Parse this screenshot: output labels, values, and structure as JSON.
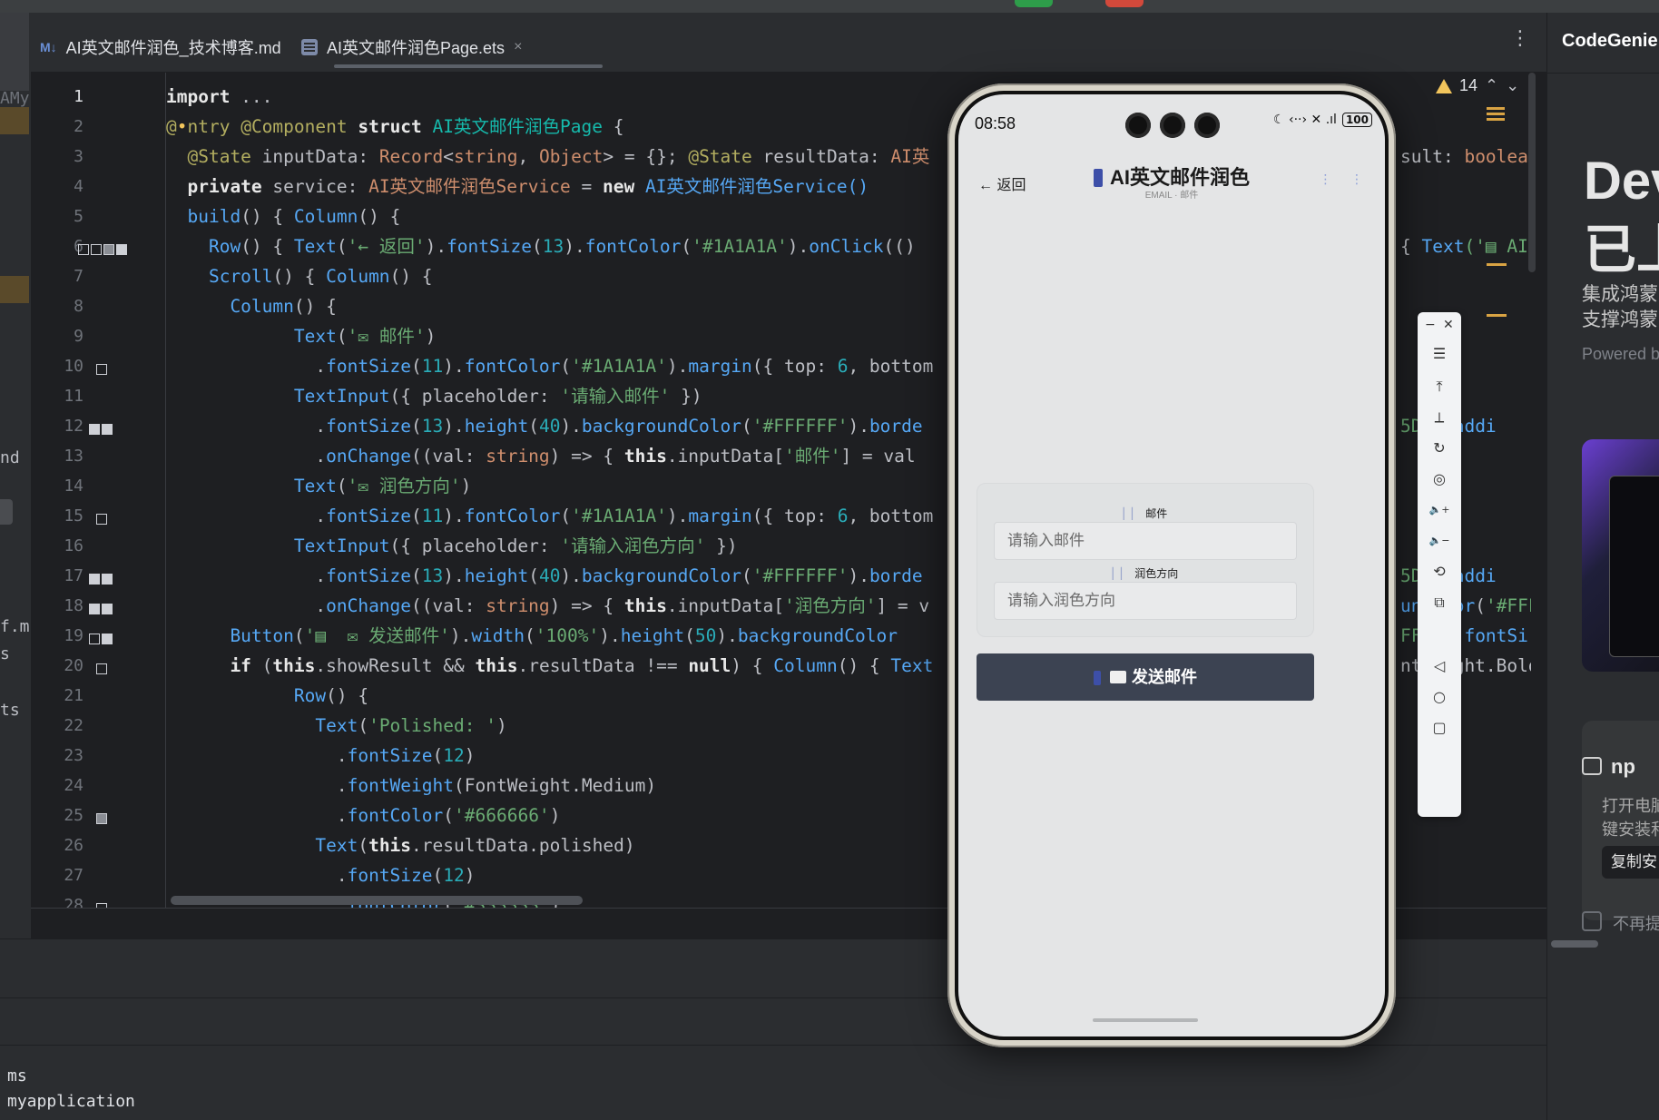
{
  "window": {
    "tabs": [
      {
        "icon": "M↓",
        "label": "AI英文邮件润色_技术博客.md",
        "active": false
      },
      {
        "icon": "ets-file",
        "label": "AI英文邮件润色Page.ets",
        "active": true,
        "close": "×"
      }
    ],
    "more_menu": "⋮"
  },
  "left_strip": {
    "fragments": [
      "AMy",
      "nd",
      "f.mc",
      "s",
      "ts"
    ]
  },
  "editor": {
    "line_numbers": [
      "1",
      "2",
      "3",
      "4",
      "5",
      "6",
      "7",
      "8",
      "9",
      "10",
      "11",
      "12",
      "13",
      "14",
      "15",
      "16",
      "17",
      "18",
      "19",
      "20",
      "21",
      "22",
      "23",
      "24",
      "25",
      "26",
      "27",
      "28"
    ],
    "warnings": {
      "count": "14"
    },
    "lines": [
      [
        {
          "t": "import ",
          "c": "kwb"
        },
        {
          "t": "...",
          "c": "pl"
        }
      ],
      [
        {
          "t": "@",
          "c": "ann"
        },
        {
          "t": "•",
          "c": "warn-ico"
        },
        {
          "t": "ntry @Component ",
          "c": "ann"
        },
        {
          "t": "struct ",
          "c": "kwb"
        },
        {
          "t": "AI英文邮件润色Page",
          "c": "ty"
        },
        {
          "t": " {",
          "c": "pl"
        }
      ],
      [
        {
          "t": "  @State ",
          "c": "ann"
        },
        {
          "t": "inputData: ",
          "c": "pl"
        },
        {
          "t": "Record",
          "c": "kw"
        },
        {
          "t": "<",
          "c": "pl"
        },
        {
          "t": "string",
          "c": "kw"
        },
        {
          "t": ", ",
          "c": "pl"
        },
        {
          "t": "Object",
          "c": "kw"
        },
        {
          "t": "> = {}; ",
          "c": "pl"
        },
        {
          "t": "@State ",
          "c": "ann"
        },
        {
          "t": "resultData: ",
          "c": "pl"
        },
        {
          "t": "AI英",
          "c": "kw"
        }
      ],
      [
        {
          "t": "  private ",
          "c": "kwb"
        },
        {
          "t": "service: ",
          "c": "pl"
        },
        {
          "t": "AI英文邮件润色Service",
          "c": "kw"
        },
        {
          "t": " = ",
          "c": "pl"
        },
        {
          "t": "new ",
          "c": "kwb"
        },
        {
          "t": "AI英文邮件润色Service()",
          "c": "fn"
        }
      ],
      [
        {
          "t": "  build",
          "c": "fn"
        },
        {
          "t": "() { ",
          "c": "pl"
        },
        {
          "t": "Column",
          "c": "fn"
        },
        {
          "t": "() {",
          "c": "pl"
        }
      ],
      [
        {
          "t": "    Row",
          "c": "fn"
        },
        {
          "t": "() { ",
          "c": "pl"
        },
        {
          "t": "Text",
          "c": "fn"
        },
        {
          "t": "(",
          "c": "pl"
        },
        {
          "t": "'← 返回'",
          "c": "str"
        },
        {
          "t": ").",
          "c": "pl"
        },
        {
          "t": "fontSize",
          "c": "fn"
        },
        {
          "t": "(",
          "c": "pl"
        },
        {
          "t": "13",
          "c": "num"
        },
        {
          "t": ").",
          "c": "pl"
        },
        {
          "t": "fontColor",
          "c": "fn"
        },
        {
          "t": "(",
          "c": "pl"
        },
        {
          "t": "'#1A1A1A'",
          "c": "str"
        },
        {
          "t": ").",
          "c": "pl"
        },
        {
          "t": "onClick",
          "c": "fn"
        },
        {
          "t": "(()",
          "c": "pl"
        }
      ],
      [
        {
          "t": "    Scroll",
          "c": "fn"
        },
        {
          "t": "() { ",
          "c": "pl"
        },
        {
          "t": "Column",
          "c": "fn"
        },
        {
          "t": "() {",
          "c": "pl"
        }
      ],
      [
        {
          "t": "      Column",
          "c": "fn"
        },
        {
          "t": "() {",
          "c": "pl"
        }
      ],
      [
        {
          "t": "            Text",
          "c": "fn"
        },
        {
          "t": "(",
          "c": "pl"
        },
        {
          "t": "'✉ 邮件'",
          "c": "str"
        },
        {
          "t": ")",
          "c": "pl"
        }
      ],
      [
        {
          "t": "              .",
          "c": "pl"
        },
        {
          "t": "fontSize",
          "c": "fn"
        },
        {
          "t": "(",
          "c": "pl"
        },
        {
          "t": "11",
          "c": "num"
        },
        {
          "t": ").",
          "c": "pl"
        },
        {
          "t": "fontColor",
          "c": "fn"
        },
        {
          "t": "(",
          "c": "pl"
        },
        {
          "t": "'#1A1A1A'",
          "c": "str"
        },
        {
          "t": ").",
          "c": "pl"
        },
        {
          "t": "margin",
          "c": "fn"
        },
        {
          "t": "({ top: ",
          "c": "pl"
        },
        {
          "t": "6",
          "c": "num"
        },
        {
          "t": ", bottom",
          "c": "pl"
        }
      ],
      [
        {
          "t": "            TextInput",
          "c": "fn"
        },
        {
          "t": "({ placeholder: ",
          "c": "pl"
        },
        {
          "t": "'请输入邮件'",
          "c": "str"
        },
        {
          "t": " })",
          "c": "pl"
        }
      ],
      [
        {
          "t": "              .",
          "c": "pl"
        },
        {
          "t": "fontSize",
          "c": "fn"
        },
        {
          "t": "(",
          "c": "pl"
        },
        {
          "t": "13",
          "c": "num"
        },
        {
          "t": ").",
          "c": "pl"
        },
        {
          "t": "height",
          "c": "fn"
        },
        {
          "t": "(",
          "c": "pl"
        },
        {
          "t": "40",
          "c": "num"
        },
        {
          "t": ").",
          "c": "pl"
        },
        {
          "t": "backgroundColor",
          "c": "fn"
        },
        {
          "t": "(",
          "c": "pl"
        },
        {
          "t": "'#FFFFFF'",
          "c": "str"
        },
        {
          "t": ").",
          "c": "pl"
        },
        {
          "t": "borde",
          "c": "fn"
        }
      ],
      [
        {
          "t": "              .",
          "c": "pl"
        },
        {
          "t": "onChange",
          "c": "fn"
        },
        {
          "t": "((val: ",
          "c": "pl"
        },
        {
          "t": "string",
          "c": "kw"
        },
        {
          "t": ") => { ",
          "c": "pl"
        },
        {
          "t": "this",
          "c": "kwb"
        },
        {
          "t": ".inputData[",
          "c": "pl"
        },
        {
          "t": "'邮件'",
          "c": "str"
        },
        {
          "t": "] = val",
          "c": "pl"
        }
      ],
      [
        {
          "t": "            Text",
          "c": "fn"
        },
        {
          "t": "(",
          "c": "pl"
        },
        {
          "t": "'✉ 润色方向'",
          "c": "str"
        },
        {
          "t": ")",
          "c": "pl"
        }
      ],
      [
        {
          "t": "              .",
          "c": "pl"
        },
        {
          "t": "fontSize",
          "c": "fn"
        },
        {
          "t": "(",
          "c": "pl"
        },
        {
          "t": "11",
          "c": "num"
        },
        {
          "t": ").",
          "c": "pl"
        },
        {
          "t": "fontColor",
          "c": "fn"
        },
        {
          "t": "(",
          "c": "pl"
        },
        {
          "t": "'#1A1A1A'",
          "c": "str"
        },
        {
          "t": ").",
          "c": "pl"
        },
        {
          "t": "margin",
          "c": "fn"
        },
        {
          "t": "({ top: ",
          "c": "pl"
        },
        {
          "t": "6",
          "c": "num"
        },
        {
          "t": ", bottom",
          "c": "pl"
        }
      ],
      [
        {
          "t": "            TextInput",
          "c": "fn"
        },
        {
          "t": "({ placeholder: ",
          "c": "pl"
        },
        {
          "t": "'请输入润色方向'",
          "c": "str"
        },
        {
          "t": " })",
          "c": "pl"
        }
      ],
      [
        {
          "t": "              .",
          "c": "pl"
        },
        {
          "t": "fontSize",
          "c": "fn"
        },
        {
          "t": "(",
          "c": "pl"
        },
        {
          "t": "13",
          "c": "num"
        },
        {
          "t": ").",
          "c": "pl"
        },
        {
          "t": "height",
          "c": "fn"
        },
        {
          "t": "(",
          "c": "pl"
        },
        {
          "t": "40",
          "c": "num"
        },
        {
          "t": ").",
          "c": "pl"
        },
        {
          "t": "backgroundColor",
          "c": "fn"
        },
        {
          "t": "(",
          "c": "pl"
        },
        {
          "t": "'#FFFFFF'",
          "c": "str"
        },
        {
          "t": ").",
          "c": "pl"
        },
        {
          "t": "borde",
          "c": "fn"
        }
      ],
      [
        {
          "t": "              .",
          "c": "pl"
        },
        {
          "t": "onChange",
          "c": "fn"
        },
        {
          "t": "((val: ",
          "c": "pl"
        },
        {
          "t": "string",
          "c": "kw"
        },
        {
          "t": ") => { ",
          "c": "pl"
        },
        {
          "t": "this",
          "c": "kwb"
        },
        {
          "t": ".inputData[",
          "c": "pl"
        },
        {
          "t": "'润色方向'",
          "c": "str"
        },
        {
          "t": "] = v",
          "c": "pl"
        }
      ],
      [
        {
          "t": "      Button",
          "c": "fn"
        },
        {
          "t": "(",
          "c": "pl"
        },
        {
          "t": "'▤  ✉ 发送邮件'",
          "c": "str"
        },
        {
          "t": ").",
          "c": "pl"
        },
        {
          "t": "width",
          "c": "fn"
        },
        {
          "t": "(",
          "c": "pl"
        },
        {
          "t": "'100%'",
          "c": "str"
        },
        {
          "t": ").",
          "c": "pl"
        },
        {
          "t": "height",
          "c": "fn"
        },
        {
          "t": "(",
          "c": "pl"
        },
        {
          "t": "50",
          "c": "num"
        },
        {
          "t": ").",
          "c": "pl"
        },
        {
          "t": "backgroundColor",
          "c": "fn"
        }
      ],
      [
        {
          "t": "      if ",
          "c": "kwb"
        },
        {
          "t": "(",
          "c": "pl"
        },
        {
          "t": "this",
          "c": "kwb"
        },
        {
          "t": ".showResult && ",
          "c": "pl"
        },
        {
          "t": "this",
          "c": "kwb"
        },
        {
          "t": ".resultData !== ",
          "c": "pl"
        },
        {
          "t": "null",
          "c": "kwb"
        },
        {
          "t": ") { ",
          "c": "pl"
        },
        {
          "t": "Column",
          "c": "fn"
        },
        {
          "t": "() { ",
          "c": "pl"
        },
        {
          "t": "Text",
          "c": "fn"
        }
      ],
      [
        {
          "t": "            Row",
          "c": "fn"
        },
        {
          "t": "() {",
          "c": "pl"
        }
      ],
      [
        {
          "t": "              Text",
          "c": "fn"
        },
        {
          "t": "(",
          "c": "pl"
        },
        {
          "t": "'Polished: '",
          "c": "str"
        },
        {
          "t": ")",
          "c": "pl"
        }
      ],
      [
        {
          "t": "                .",
          "c": "pl"
        },
        {
          "t": "fontSize",
          "c": "fn"
        },
        {
          "t": "(",
          "c": "pl"
        },
        {
          "t": "12",
          "c": "num"
        },
        {
          "t": ")",
          "c": "pl"
        }
      ],
      [
        {
          "t": "                .",
          "c": "pl"
        },
        {
          "t": "fontWeight",
          "c": "fn"
        },
        {
          "t": "(FontWeight.Medium)",
          "c": "pl"
        }
      ],
      [
        {
          "t": "                .",
          "c": "pl"
        },
        {
          "t": "fontColor",
          "c": "fn"
        },
        {
          "t": "(",
          "c": "pl"
        },
        {
          "t": "'#666666'",
          "c": "str"
        },
        {
          "t": ")",
          "c": "pl"
        }
      ],
      [
        {
          "t": "              Text",
          "c": "fn"
        },
        {
          "t": "(",
          "c": "pl"
        },
        {
          "t": "this",
          "c": "kwb"
        },
        {
          "t": ".resultData.polished)",
          "c": "pl"
        }
      ],
      [
        {
          "t": "                .",
          "c": "pl"
        },
        {
          "t": "fontSize",
          "c": "fn"
        },
        {
          "t": "(",
          "c": "pl"
        },
        {
          "t": "12",
          "c": "num"
        },
        {
          "t": ")",
          "c": "pl"
        }
      ],
      [
        {
          "t": "                .",
          "c": "pl"
        },
        {
          "t": "fontColor",
          "c": "fn"
        },
        {
          "t": "(",
          "c": "pl"
        },
        {
          "t": "'#333333'",
          "c": "str"
        },
        {
          "t": ")",
          "c": "pl"
        }
      ]
    ],
    "right_fragments": [
      {
        "line": 3,
        "parts": [
          {
            "t": "sult: ",
            "c": "pl"
          },
          {
            "t": "boolean",
            "c": "kw"
          }
        ]
      },
      {
        "line": 6,
        "parts": [
          {
            "t": "{ ",
            "c": "pl"
          },
          {
            "t": "Text",
            "c": "fn"
          },
          {
            "t": "('▤ AI",
            "c": "str"
          }
        ]
      },
      {
        "line": 12,
        "parts": [
          {
            "t": "5D",
            "c": "str"
          },
          {
            "t": ").",
            "c": "pl"
          },
          {
            "t": "paddi",
            "c": "fn"
          }
        ]
      },
      {
        "line": 17,
        "parts": [
          {
            "t": "5D",
            "c": "str"
          },
          {
            "t": ").",
            "c": "pl"
          },
          {
            "t": "paddi",
            "c": "fn"
          }
        ]
      },
      {
        "line": 18,
        "parts": [
          {
            "t": "un",
            "c": "fn"
          },
          {
            "t": "   ",
            "c": "pl"
          },
          {
            "t": "or",
            "c": "fn"
          },
          {
            "t": "(",
            "c": "pl"
          },
          {
            "t": "'#FFF",
            "c": "str"
          }
        ]
      },
      {
        "line": 19,
        "parts": [
          {
            "t": "FF",
            "c": "str"
          },
          {
            "t": "   .",
            "c": "pl"
          },
          {
            "t": "fontSi",
            "c": "fn"
          }
        ]
      },
      {
        "line": 20,
        "parts": [
          {
            "t": "nt",
            "c": "pl"
          },
          {
            "t": "   ght.Bold)",
            "c": "pl"
          }
        ]
      }
    ]
  },
  "bottom_panel": {
    "lines": [
      "ms",
      "myapplication"
    ]
  },
  "right_panel": {
    "title": "CodeGenie",
    "heading_1": "Dev",
    "heading_2": "已上",
    "desc_1": "集成鸿蒙",
    "desc_2": "支撑鸿蒙",
    "powered": "Powered b",
    "npm_title": "np",
    "npm_desc_1": "打开电脑",
    "npm_desc_2": "键安装和",
    "copy_button": "复制安",
    "dont_show": "不再提"
  },
  "phone": {
    "time": "08:58",
    "status_icons": "☾ ‹··› ✕ .ıl",
    "battery": "100",
    "back": "← 返回",
    "title": "AI英文邮件润色",
    "subtitle": "EMAIL · 邮件",
    "nav_dots": "⋮ ⋮",
    "field_1_label": "邮件",
    "field_1_placeholder": "请输入邮件",
    "field_2_label": "润色方向",
    "field_2_placeholder": "请输入润色方向",
    "send_button": "发送邮件"
  },
  "emulator_toolbar": {
    "minimize": "−",
    "close": "✕",
    "buttons": [
      "☰",
      "⤒",
      "⟂",
      "↻",
      "◎",
      "🔈+",
      "🔈−",
      "⟲",
      "⧉",
      "◁",
      "○",
      "▢"
    ]
  },
  "colors": {
    "accent": "#3c4352",
    "editor_bg": "#1e1f22",
    "panel_bg": "#2b2d30"
  }
}
